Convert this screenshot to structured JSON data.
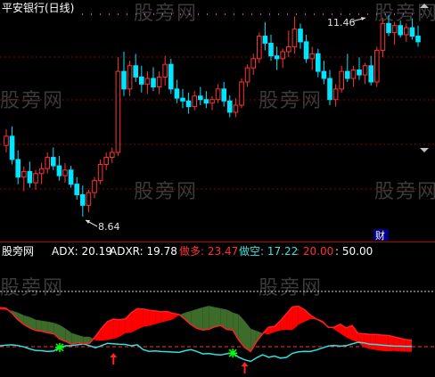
{
  "main_panel": {
    "title": "平安银行(日线)",
    "high_label": "11.46",
    "low_label": "8.64",
    "cai_label": "财"
  },
  "watermark": "股旁网",
  "indicator_panel": {
    "name": "股旁网",
    "adx_label": "ADX: 20.19",
    "adxr_label": "ADXR: 19.78",
    "duo_label": "做多: 23.47",
    "kong_label": "做空: 17.22",
    "level_20_label": ": 20.00",
    "level_50_label": ": 50.00"
  },
  "colors": {
    "up": "#ff3232",
    "down": "#00e5ff",
    "duo_line": "#ff2020",
    "kong_line": "#30e0e0",
    "duo_fill": "#ff0000",
    "kong_fill": "#3d6b2a",
    "grid": "#8b0000",
    "title_text": "#ffffff",
    "marker_cross": "#00ff00",
    "marker_arrow": "#ff2020"
  },
  "chart_data": [
    {
      "type": "candlestick",
      "title": "平安银行(日线)",
      "annotations": [
        {
          "text": "11.46",
          "kind": "high"
        },
        {
          "text": "8.64",
          "kind": "low"
        }
      ],
      "ohlc": [
        [
          9.65,
          9.88,
          9.55,
          9.78
        ],
        [
          9.78,
          9.92,
          9.38,
          9.45
        ],
        [
          9.45,
          9.58,
          9.1,
          9.2
        ],
        [
          9.2,
          9.35,
          9.0,
          9.28
        ],
        [
          9.28,
          9.42,
          9.05,
          9.12
        ],
        [
          9.12,
          9.3,
          9.02,
          9.25
        ],
        [
          9.25,
          9.4,
          9.1,
          9.32
        ],
        [
          9.32,
          9.55,
          9.25,
          9.48
        ],
        [
          9.48,
          9.62,
          9.3,
          9.36
        ],
        [
          9.36,
          9.5,
          9.15,
          9.22
        ],
        [
          9.22,
          9.4,
          9.12,
          9.3
        ],
        [
          9.3,
          9.36,
          9.05,
          9.1
        ],
        [
          9.1,
          9.2,
          8.88,
          8.95
        ],
        [
          8.95,
          9.08,
          8.64,
          8.8
        ],
        [
          8.8,
          9.02,
          8.7,
          8.98
        ],
        [
          8.98,
          9.2,
          8.9,
          9.15
        ],
        [
          9.15,
          9.45,
          9.1,
          9.38
        ],
        [
          9.38,
          9.55,
          9.3,
          9.48
        ],
        [
          9.48,
          9.62,
          9.4,
          9.55
        ],
        [
          9.55,
          10.9,
          9.5,
          10.7
        ],
        [
          10.7,
          10.98,
          10.35,
          10.45
        ],
        [
          10.45,
          10.85,
          10.35,
          10.78
        ],
        [
          10.78,
          10.95,
          10.55,
          10.62
        ],
        [
          10.62,
          10.78,
          10.4,
          10.52
        ],
        [
          10.52,
          10.7,
          10.38,
          10.6
        ],
        [
          10.6,
          10.76,
          10.42,
          10.48
        ],
        [
          10.48,
          10.7,
          10.38,
          10.62
        ],
        [
          10.62,
          10.92,
          10.5,
          10.8
        ],
        [
          10.8,
          10.88,
          10.38,
          10.45
        ],
        [
          10.45,
          10.58,
          10.25,
          10.32
        ],
        [
          10.32,
          10.45,
          10.18,
          10.28
        ],
        [
          10.28,
          10.4,
          10.1,
          10.2
        ],
        [
          10.2,
          10.42,
          10.15,
          10.35
        ],
        [
          10.35,
          10.48,
          10.22,
          10.3
        ],
        [
          10.3,
          10.42,
          10.18,
          10.25
        ],
        [
          10.25,
          10.35,
          10.15,
          10.3
        ],
        [
          10.3,
          10.52,
          10.25,
          10.45
        ],
        [
          10.45,
          10.55,
          10.2,
          10.28
        ],
        [
          10.28,
          10.36,
          10.05,
          10.12
        ],
        [
          10.12,
          10.32,
          10.05,
          10.22
        ],
        [
          10.22,
          10.6,
          10.18,
          10.55
        ],
        [
          10.55,
          10.8,
          10.48,
          10.75
        ],
        [
          10.75,
          10.95,
          10.65,
          10.88
        ],
        [
          10.88,
          11.25,
          10.82,
          11.2
        ],
        [
          11.2,
          11.4,
          11.0,
          11.1
        ],
        [
          11.1,
          11.22,
          10.85,
          10.92
        ],
        [
          10.92,
          11.05,
          10.72,
          10.88
        ],
        [
          10.88,
          11.02,
          10.75,
          10.98
        ],
        [
          10.98,
          11.28,
          10.9,
          11.05
        ],
        [
          11.05,
          11.48,
          10.95,
          11.3
        ],
        [
          11.3,
          11.38,
          11.02,
          11.12
        ],
        [
          11.12,
          11.22,
          10.82,
          10.88
        ],
        [
          10.88,
          11.05,
          10.72,
          10.95
        ],
        [
          10.95,
          11.02,
          10.62,
          10.7
        ],
        [
          10.7,
          10.85,
          10.52,
          10.6
        ],
        [
          10.6,
          10.72,
          10.22,
          10.3
        ],
        [
          10.3,
          10.52,
          10.2,
          10.45
        ],
        [
          10.45,
          10.78,
          10.4,
          10.7
        ],
        [
          10.7,
          10.95,
          10.55,
          10.6
        ],
        [
          10.6,
          10.78,
          10.48,
          10.72
        ],
        [
          10.72,
          10.9,
          10.58,
          10.65
        ],
        [
          10.65,
          10.82,
          10.52,
          10.78
        ],
        [
          10.78,
          10.92,
          10.5,
          10.55
        ],
        [
          10.55,
          11.05,
          10.48,
          11.0
        ],
        [
          11.0,
          11.46,
          10.9,
          11.38
        ],
        [
          11.38,
          11.5,
          11.2,
          11.25
        ],
        [
          11.25,
          11.4,
          11.08,
          11.35
        ],
        [
          11.35,
          11.42,
          11.18,
          11.22
        ],
        [
          11.22,
          11.38,
          11.12,
          11.32
        ],
        [
          11.32,
          11.45,
          11.15,
          11.2
        ],
        [
          11.2,
          11.35,
          11.05,
          11.12
        ]
      ]
    },
    {
      "type": "line",
      "title": "股旁网",
      "ylim": [
        0,
        60
      ],
      "reference_levels": [
        20,
        50
      ],
      "series": [
        {
          "name": "ADX",
          "values": [
            20.5,
            20.8,
            21.0,
            20.6,
            19.9,
            18.8,
            17.9,
            17.8,
            17.4,
            17.7,
            19.6,
            20.5,
            20.6,
            21.0,
            21.5,
            20.6,
            19.4,
            20.6,
            21.8,
            21.6,
            21.3,
            21.2,
            20.5,
            21.0,
            18.4,
            17.5,
            17.7,
            17.4,
            17.3,
            17.1,
            16.9,
            17.8,
            18.4,
            17.4,
            16.1,
            16.3,
            15.8,
            15.5,
            16.2,
            16.5,
            14.3,
            12.9,
            12.0,
            14.0,
            15.6,
            14.3,
            14.9,
            13.8,
            14.2,
            16.4,
            17.2,
            17.5,
            17.4,
            18.2,
            19.3,
            20.4,
            20.7,
            20.3,
            20.6,
            21.5,
            22.4,
            22.1,
            21.3,
            21.2,
            20.8,
            20.6,
            20.4,
            20.3,
            20.2,
            20.2
          ]
        },
        {
          "name": "做多",
          "values": [
            41.2,
            40.9,
            38.2,
            34.6,
            32.1,
            30.2,
            28.8,
            28.4,
            27.5,
            27.0,
            24.1,
            22.9,
            21.3,
            22.1,
            21.7,
            21.8,
            25.6,
            29.9,
            33.6,
            35.0,
            34.6,
            35.1,
            38.4,
            40.6,
            40.4,
            39.8,
            39.4,
            38.9,
            39.1,
            38.1,
            37.5,
            34.8,
            32.0,
            29.9,
            29.1,
            29.5,
            30.8,
            31.5,
            29.4,
            29.1,
            23.7,
            19.5,
            17.4,
            22.8,
            27.0,
            30.6,
            31.0,
            34.2,
            37.9,
            41.6,
            41.9,
            40.1,
            37.2,
            35.0,
            33.7,
            30.5,
            30.6,
            32.2,
            30.2,
            31.5,
            27.2,
            27.0,
            26.7,
            26.7,
            26.3,
            26.1,
            25.4,
            24.6,
            23.8,
            23.5
          ]
        },
        {
          "name": "做空",
          "values": [
            40.2,
            40.0,
            39.6,
            38.5,
            37.0,
            36.1,
            34.6,
            34.2,
            33.6,
            33.0,
            31.8,
            29.8,
            27.5,
            26.4,
            25.4,
            25.4,
            23.4,
            23.2,
            23.7,
            24.2,
            25.3,
            27.3,
            27.6,
            29.3,
            30.8,
            31.3,
            32.2,
            33.2,
            34.0,
            34.9,
            37.2,
            38.5,
            39.4,
            40.4,
            41.4,
            42.2,
            41.5,
            40.8,
            40.2,
            38.6,
            37.5,
            34.0,
            29.8,
            28.6,
            27.3,
            26.7,
            28.0,
            28.8,
            29.2,
            29.0,
            31.9,
            33.5,
            35.0,
            34.8,
            32.8,
            31.1,
            29.4,
            27.2,
            25.1,
            23.6,
            22.2,
            19.7,
            18.8,
            18.2,
            17.7,
            17.5,
            17.7,
            17.4,
            17.3,
            17.2
          ]
        }
      ]
    }
  ]
}
